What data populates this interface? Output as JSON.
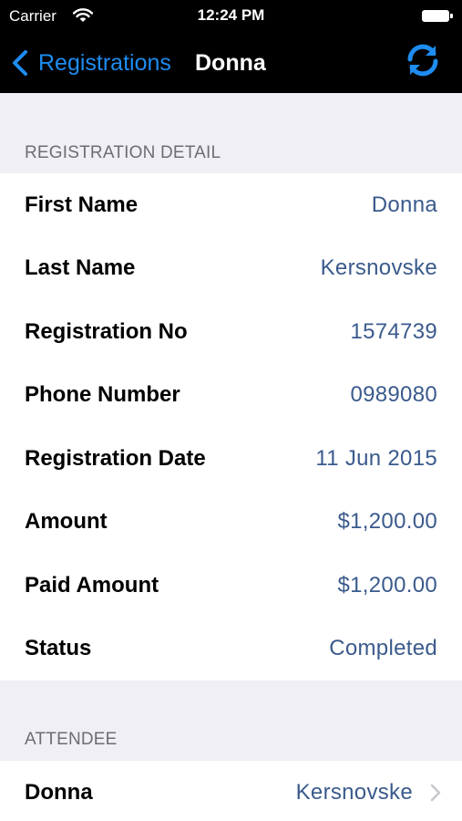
{
  "status_bar": {
    "carrier": "Carrier",
    "time": "12:24 PM"
  },
  "nav": {
    "back_label": "Registrations",
    "title": "Donna"
  },
  "sections": {
    "detail_header": "REGISTRATION DETAIL",
    "attendee_header": "ATTENDEE"
  },
  "details": [
    {
      "label": "First Name",
      "value": "Donna"
    },
    {
      "label": "Last Name",
      "value": "Kersnovske"
    },
    {
      "label": "Registration No",
      "value": "1574739"
    },
    {
      "label": "Phone Number",
      "value": "0989080"
    },
    {
      "label": "Registration Date",
      "value": "11 Jun 2015"
    },
    {
      "label": "Amount",
      "value": "$1,200.00"
    },
    {
      "label": "Paid Amount",
      "value": "$1,200.00"
    },
    {
      "label": "Status",
      "value": "Completed"
    }
  ],
  "attendee": {
    "first_name": "Donna",
    "last_name": "Kersnovske"
  },
  "icons": {
    "wifi": "wifi-icon",
    "battery": "battery-icon",
    "back": "chevron-left-icon",
    "refresh": "refresh-icon",
    "disclosure": "chevron-right-icon"
  },
  "colors": {
    "accent": "#1e8cf0",
    "value_text": "#3a5a8c",
    "background": "#efeff4"
  }
}
